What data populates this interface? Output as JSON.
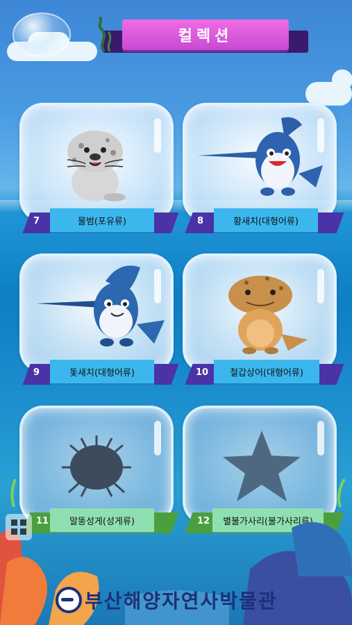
{
  "title": "컬렉션",
  "cards": [
    {
      "number": "7",
      "name": "물범(포유류)",
      "state": "unlocked",
      "creature": "seal"
    },
    {
      "number": "8",
      "name": "황새치(대형어류)",
      "state": "unlocked",
      "creature": "swordfish"
    },
    {
      "number": "9",
      "name": "돛새치(대형어류)",
      "state": "unlocked",
      "creature": "sailfish"
    },
    {
      "number": "10",
      "name": "철갑상어(대형어류)",
      "state": "unlocked",
      "creature": "sturgeon"
    },
    {
      "number": "11",
      "name": "말똥성게(성게류)",
      "state": "locked",
      "creature": "sea-urchin-silhouette"
    },
    {
      "number": "12",
      "name": "별불가사리(불가사리류)",
      "state": "locked",
      "creature": "starfish-silhouette"
    }
  ],
  "footer": {
    "museum_name": "부산해양자연사박물관"
  },
  "colors": {
    "title_banner": "#e35fdf",
    "label_unlocked": "#3bb7ee",
    "label_locked": "#8fe0b0",
    "label_back_unlocked": "#4a33a6",
    "label_back_locked": "#4b9f3e"
  }
}
